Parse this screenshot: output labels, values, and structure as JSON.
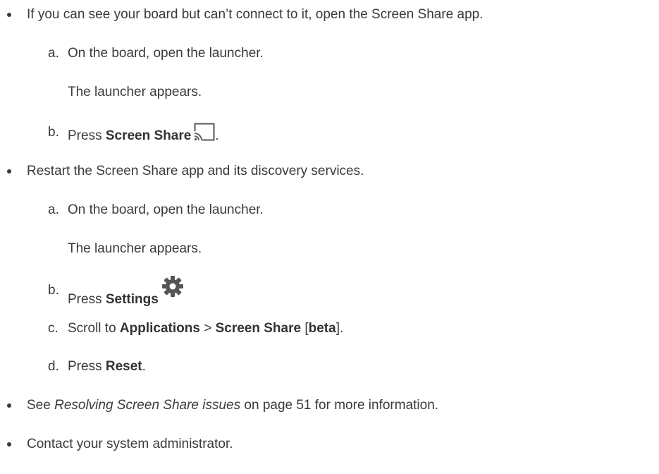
{
  "bullets": {
    "b1": {
      "text": "If you can see your board but can’t connect to it, open the Screen Share app.",
      "steps": [
        {
          "marker": "a.",
          "text": "On the board, open the launcher.",
          "result": "The launcher appears."
        },
        {
          "marker": "b.",
          "prefix": "Press ",
          "bold": "Screen Share",
          "suffix": ".",
          "icon": "screen-share-icon"
        }
      ]
    },
    "b2": {
      "text": "Restart the Screen Share app and its discovery services.",
      "steps": [
        {
          "marker": "a.",
          "text": "On the board, open the launcher.",
          "result": "The launcher appears."
        },
        {
          "marker": "b.",
          "prefix": "Press ",
          "bold": "Settings",
          "icon": "gear-icon"
        },
        {
          "marker": "c.",
          "prefix": "Scroll to ",
          "bold1": "Applications",
          "sep": " > ",
          "bold2": "Screen Share",
          "mid": " [",
          "bold3": "beta",
          "suffix": "]."
        },
        {
          "marker": "d.",
          "prefix": "Press ",
          "bold": "Reset",
          "suffix": "."
        }
      ]
    },
    "b3": {
      "prefix": "See ",
      "italic": "Resolving Screen Share issues",
      "suffix": " on page 51 for more information."
    },
    "b4": {
      "text": "Contact your system administrator."
    }
  }
}
